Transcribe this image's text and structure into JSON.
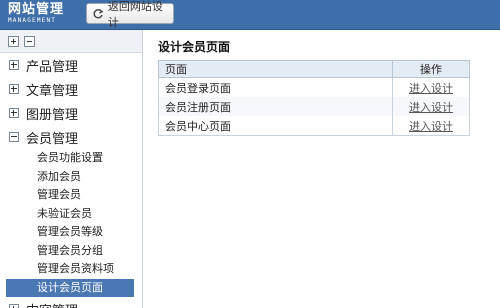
{
  "brand": {
    "title": "网站管理",
    "subtitle": "MANAGEMENT"
  },
  "toolbar": {
    "back_label": "返回网站设计"
  },
  "sidebar": {
    "groups": [
      {
        "label": "产品管理",
        "expanded": false
      },
      {
        "label": "文章管理",
        "expanded": false
      },
      {
        "label": "图册管理",
        "expanded": false
      },
      {
        "label": "会员管理",
        "expanded": true,
        "items": [
          "会员功能设置",
          "添加会员",
          "管理会员",
          "未验证会员",
          "管理会员等级",
          "管理会员分组",
          "管理会员资料项",
          "设计会员页面"
        ],
        "active_index": 7
      }
    ],
    "partial_next_label": "内容管理"
  },
  "main": {
    "title": "设计会员页面",
    "columns": [
      "页面",
      "操作"
    ],
    "rows": [
      {
        "page": "会员登录页面",
        "action": "进入设计"
      },
      {
        "page": "会员注册页面",
        "action": "进入设计"
      },
      {
        "page": "会员中心页面",
        "action": "进入设计"
      }
    ]
  },
  "colors": {
    "header_bg": "#3f6fa8",
    "active_item": "#4a78b3",
    "table_head": "#e4ebf3"
  }
}
